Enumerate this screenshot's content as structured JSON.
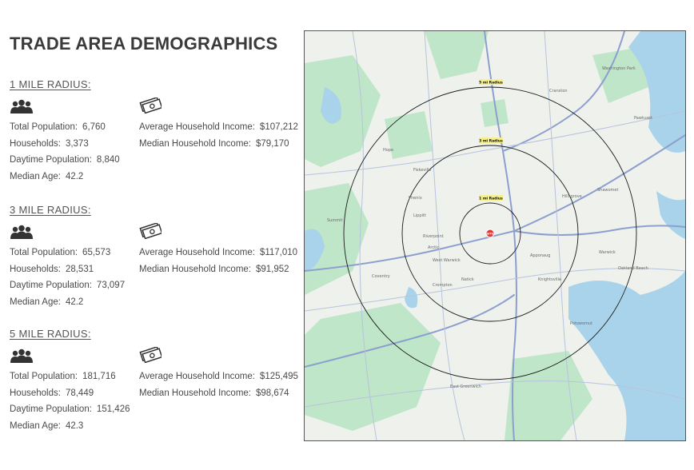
{
  "title": "TRADE AREA DEMOGRAPHICS",
  "sections": [
    {
      "heading": "1 MILE RADIUS:",
      "population_label": "Total Population:",
      "population": "6,760",
      "households_label": "Households:",
      "households": "3,373",
      "daytime_label": "Daytime Population:",
      "daytime": "8,840",
      "age_label": "Median Age:",
      "age": "42.2",
      "avg_income_label": "Average Household Income:",
      "avg_income": "$107,212",
      "med_income_label": "Median Household Income:",
      "med_income": "$79,170"
    },
    {
      "heading": "3 MILE RADIUS:",
      "population_label": "Total Population:",
      "population": "65,573",
      "households_label": "Households:",
      "households": "28,531",
      "daytime_label": "Daytime Population:",
      "daytime": "73,097",
      "age_label": "Median Age:",
      "age": "42.2",
      "avg_income_label": "Average Household Income:",
      "avg_income": "$117,010",
      "med_income_label": "Median Household Income:",
      "med_income": "$91,952"
    },
    {
      "heading": "5 MILE RADIUS:",
      "population_label": "Total Population:",
      "population": "181,716",
      "households_label": "Households:",
      "households": "78,449",
      "daytime_label": "Daytime Population:",
      "daytime": "151,426",
      "age_label": "Median Age:",
      "age": "42.3",
      "avg_income_label": "Average Household Income:",
      "avg_income": "$125,495",
      "med_income_label": "Median Household Income:",
      "med_income": "$98,674"
    }
  ],
  "map": {
    "ring_labels": [
      "1 mi Radius",
      "3 mi Radius",
      "5 mi Radius"
    ],
    "site_label": "SITE",
    "place_labels": [
      "Cranston",
      "West Warwick",
      "Warwick",
      "Coventry",
      "East Greenwich",
      "Fiskeville",
      "Hope",
      "Arctic",
      "Crompton",
      "Washington Park",
      "Potowomut",
      "Apponaug",
      "Hillsgrove",
      "Oakland Beach",
      "Pawtuxet",
      "Natick",
      "Knightsville",
      "Lippitt",
      "Riverpoint",
      "Phenix",
      "Summit",
      "Shawomet"
    ],
    "icons": {
      "people": "people-group-icon",
      "money": "money-bills-icon",
      "site": "site-pin-icon"
    },
    "colors": {
      "water": "#a9d3ea",
      "park": "#bfe6c8",
      "land": "#eef1ec",
      "road": "#8d9fcf",
      "ring": "#1a1a1a",
      "site": "#d93a3a"
    }
  }
}
